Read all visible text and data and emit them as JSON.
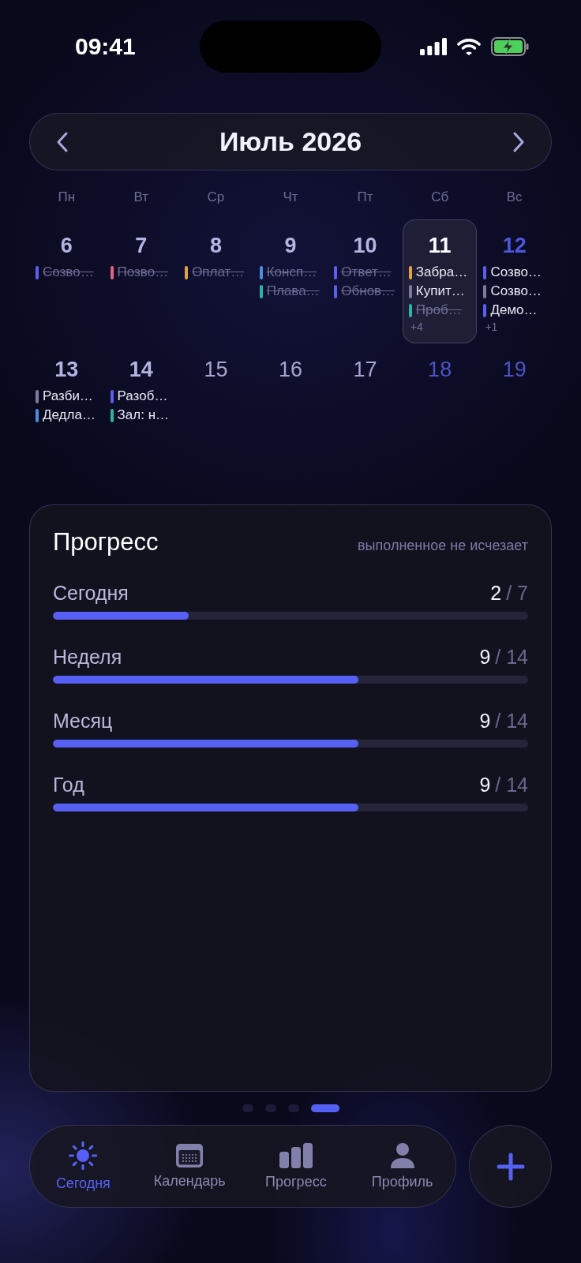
{
  "status_bar": {
    "time": "09:41"
  },
  "header": {
    "title": "Июль 2026"
  },
  "calendar": {
    "weekdays": [
      "Пн",
      "Вт",
      "Ср",
      "Чт",
      "Пт",
      "Сб",
      "Вс"
    ],
    "weeks": [
      {
        "days": [
          {
            "number": "6",
            "weekend": false,
            "selected": false,
            "events": [
              {
                "title": "Созво…",
                "color": "#5a5ff0",
                "done": true
              }
            ]
          },
          {
            "number": "7",
            "weekend": false,
            "selected": false,
            "events": [
              {
                "title": "Позво…",
                "color": "#e0647f",
                "done": true
              }
            ]
          },
          {
            "number": "8",
            "weekend": false,
            "selected": false,
            "events": [
              {
                "title": "Оплат…",
                "color": "#e3a246",
                "done": true
              }
            ]
          },
          {
            "number": "9",
            "weekend": false,
            "selected": false,
            "events": [
              {
                "title": "Консп…",
                "color": "#4a8ee0",
                "done": true
              },
              {
                "title": "Плава…",
                "color": "#2bb3a3",
                "done": true
              }
            ]
          },
          {
            "number": "10",
            "weekend": false,
            "selected": false,
            "events": [
              {
                "title": "Ответ…",
                "color": "#5a5ff0",
                "done": true
              },
              {
                "title": "Обнов…",
                "color": "#5a5ff0",
                "done": true
              }
            ]
          },
          {
            "number": "11",
            "selected": true,
            "events": [
              {
                "title": "Забра…",
                "color": "#e3a246",
                "done": false
              },
              {
                "title": "Купит…",
                "color": "#7a7a9e",
                "done": false
              },
              {
                "title": "Проб…",
                "color": "#2bb3a3",
                "done": true
              }
            ],
            "more": "+4"
          },
          {
            "number": "12",
            "weekend": true,
            "selected": false,
            "events": [
              {
                "title": "Созво…",
                "color": "#5a5ff0",
                "done": false
              },
              {
                "title": "Созво…",
                "color": "#7a7a9e",
                "done": false
              },
              {
                "title": "Демо…",
                "color": "#5a5ff0",
                "done": false
              }
            ],
            "more": "+1"
          }
        ]
      },
      {
        "days": [
          {
            "number": "13",
            "weekend": false,
            "selected": false,
            "events": [
              {
                "title": "Разби…",
                "color": "#7a7a9e",
                "done": false
              },
              {
                "title": "Дедла…",
                "color": "#4a8ee0",
                "done": false
              }
            ]
          },
          {
            "number": "14",
            "weekend": false,
            "selected": false,
            "events": [
              {
                "title": "Разоб…",
                "color": "#5a5ff0",
                "done": false
              },
              {
                "title": "Зал: н…",
                "color": "#2bb3a3",
                "done": false
              }
            ]
          },
          {
            "number": "15",
            "weekend": false,
            "selected": false
          },
          {
            "number": "16",
            "weekend": false,
            "selected": false
          },
          {
            "number": "17",
            "weekend": false,
            "selected": false
          },
          {
            "number": "18",
            "weekend": true,
            "selected": false
          },
          {
            "number": "19",
            "weekend": true,
            "selected": false
          }
        ]
      }
    ]
  },
  "progress": {
    "title": "Прогресс",
    "note": "выполненное не исчезает",
    "rows": [
      {
        "label": "Сегодня",
        "done": "2",
        "total": "/ 7",
        "level": 0.286
      },
      {
        "label": "Неделя",
        "done": "9",
        "total": "/ 14",
        "level": 0.643
      },
      {
        "label": "Месяц",
        "done": "9",
        "total": "/ 14",
        "level": 0.643
      },
      {
        "label": "Год",
        "done": "9",
        "total": "/ 14",
        "level": 0.643
      }
    ]
  },
  "pager": {
    "pages": [
      {
        "selected": false
      },
      {
        "selected": false
      },
      {
        "selected": false
      },
      {
        "selected": true
      }
    ]
  },
  "tab_bar": {
    "tabs": [
      {
        "label": "Сегодня",
        "kind": "sun",
        "selected": true
      },
      {
        "label": "Календарь",
        "kind": "calendar",
        "selected": false
      },
      {
        "label": "Прогресс",
        "kind": "chart",
        "selected": false
      },
      {
        "label": "Профиль",
        "kind": "person",
        "selected": false
      }
    ]
  }
}
